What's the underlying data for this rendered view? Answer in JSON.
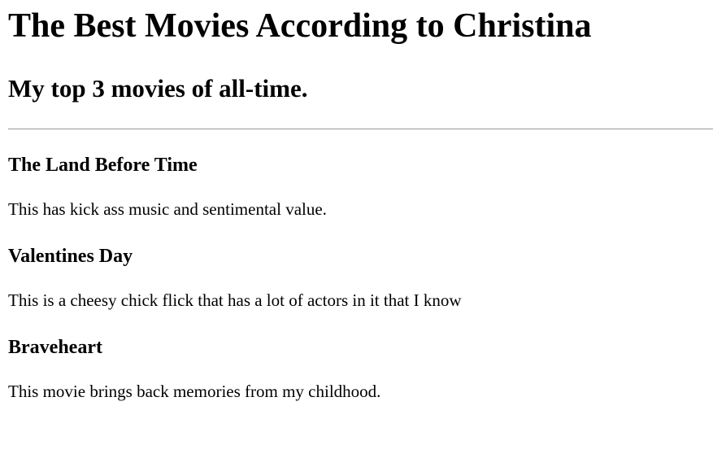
{
  "page": {
    "title": "The Best Movies According to Christina",
    "subtitle": "My top 3 movies of all-time."
  },
  "movies": [
    {
      "title": "The Land Before Time",
      "description": "This has kick ass music and sentimental value."
    },
    {
      "title": "Valentines Day",
      "description": "This is a cheesy chick flick that has a lot of actors in it that I know"
    },
    {
      "title": "Braveheart",
      "description": "This movie brings back memories from my childhood."
    }
  ]
}
